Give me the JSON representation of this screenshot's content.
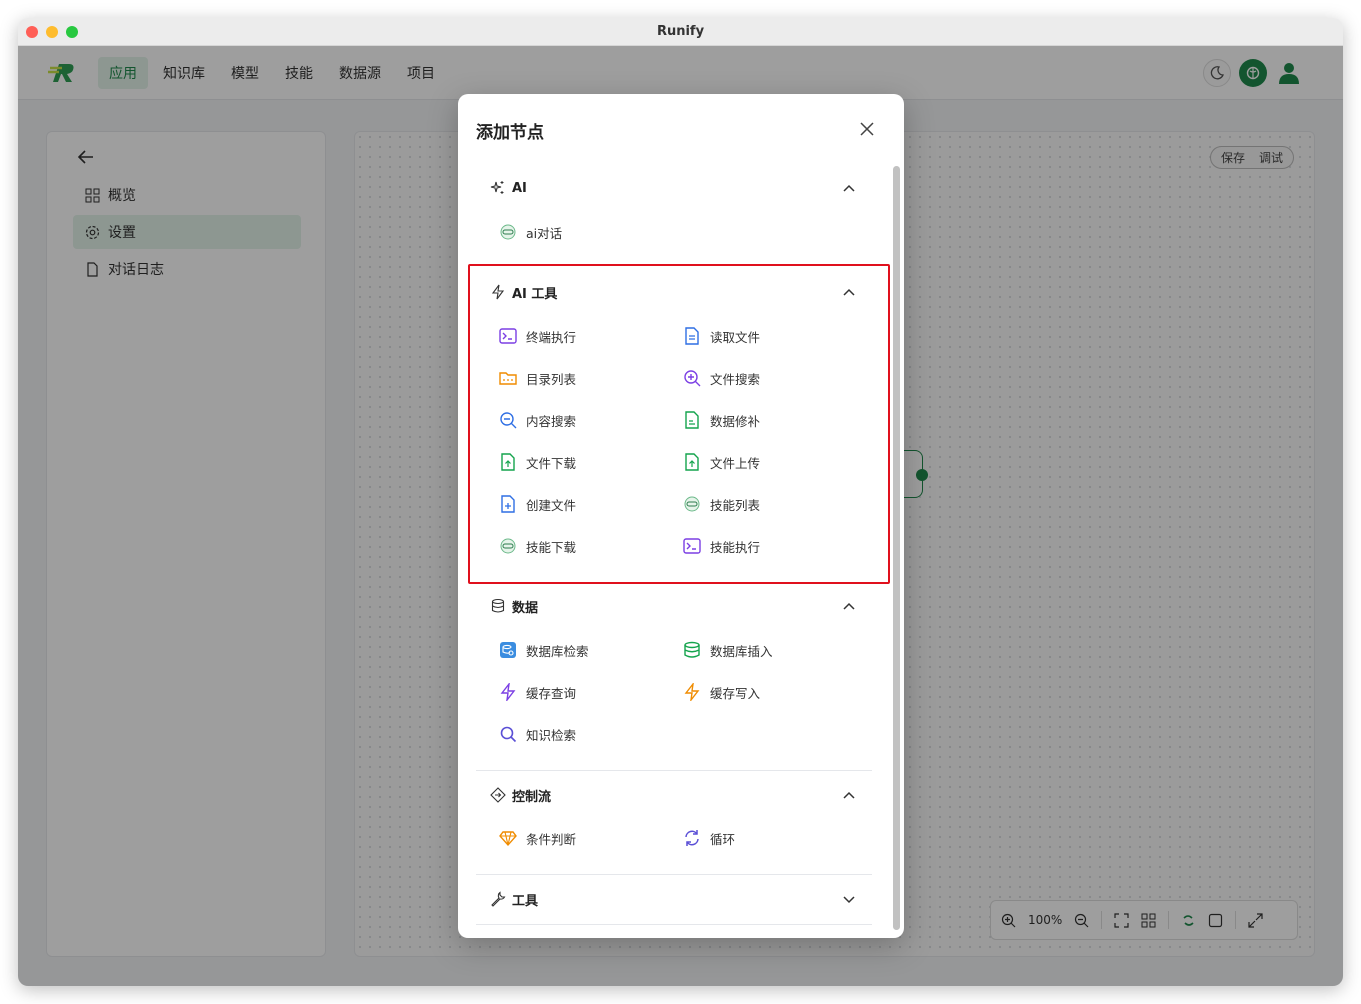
{
  "window": {
    "title": "Runify"
  },
  "header": {
    "nav": [
      "应用",
      "知识库",
      "模型",
      "技能",
      "数据源",
      "项目"
    ],
    "active_nav": "应用",
    "brand_color": "#1f8a4c"
  },
  "sidebar": {
    "items": [
      {
        "label": "概览",
        "icon": "grid-icon"
      },
      {
        "label": "设置",
        "icon": "gear-icon"
      },
      {
        "label": "对话日志",
        "icon": "file-icon"
      }
    ],
    "active": "设置"
  },
  "canvas": {
    "actions": [
      "保存",
      "调试"
    ],
    "zoom_label": "100%"
  },
  "modal": {
    "title": "添加节点",
    "sections": {
      "ai": {
        "title": "AI",
        "items": [
          "ai对话"
        ]
      },
      "ai_tools": {
        "title": "AI 工具",
        "items": [
          "终端执行",
          "读取文件",
          "目录列表",
          "文件搜索",
          "内容搜索",
          "数据修补",
          "文件下载",
          "文件上传",
          "创建文件",
          "技能列表",
          "技能下载",
          "技能执行"
        ]
      },
      "data": {
        "title": "数据",
        "items": [
          "数据库检索",
          "数据库插入",
          "缓存查询",
          "缓存写入",
          "知识检索"
        ]
      },
      "control": {
        "title": "控制流",
        "items": [
          "条件判断",
          "循环"
        ]
      },
      "tools": {
        "title": "工具",
        "items": []
      }
    }
  }
}
